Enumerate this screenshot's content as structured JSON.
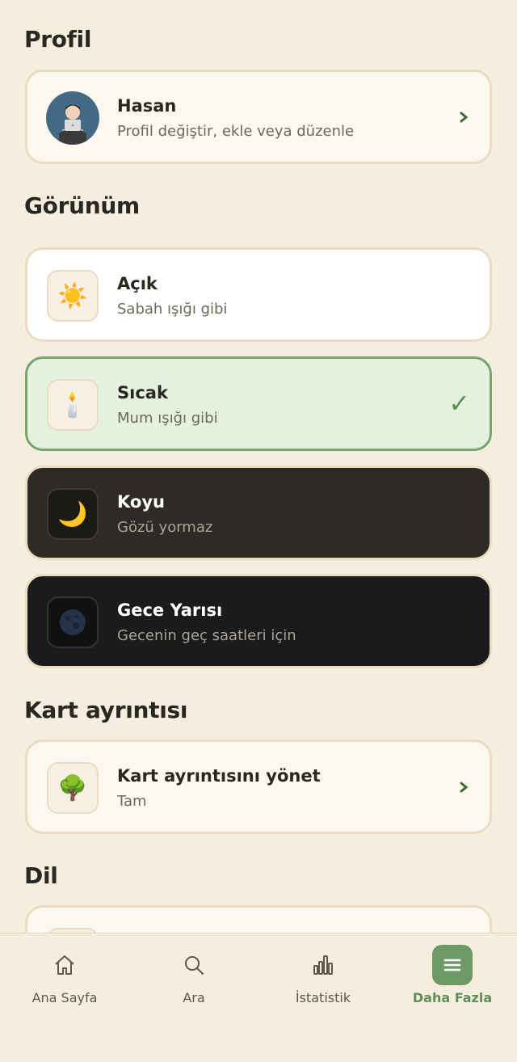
{
  "sections": {
    "profile": "Profil",
    "appearance": "Görünüm",
    "card_detail": "Kart ayrıntısı",
    "language": "Dil"
  },
  "profile": {
    "name": "Hasan",
    "subtitle": "Profil değiştir, ekle veya düzenle"
  },
  "themes": [
    {
      "title": "Açık",
      "subtitle": "Sabah ışığı gibi",
      "icon": "sun-icon",
      "glyph": "☀️"
    },
    {
      "title": "Sıcak",
      "subtitle": "Mum ışığı gibi",
      "icon": "candle-icon",
      "glyph": "🕯️",
      "selected": true
    },
    {
      "title": "Koyu",
      "subtitle": "Gözü yormaz",
      "icon": "moon-icon",
      "glyph": "🌙"
    },
    {
      "title": "Gece Yarısı",
      "subtitle": "Gecenin geç saatleri için",
      "icon": "dark-globe-icon",
      "glyph": "🌑"
    }
  ],
  "card_detail": {
    "title": "Kart ayrıntısını yönet",
    "subtitle": "Tam",
    "icon": "tree-icon",
    "glyph": "🌳"
  },
  "check_glyph": "✓",
  "tabs": [
    {
      "label": "Ana Sayfa",
      "icon": "home-icon"
    },
    {
      "label": "Ara",
      "icon": "search-icon"
    },
    {
      "label": "İstatistik",
      "icon": "stats-icon"
    },
    {
      "label": "Daha Fazla",
      "icon": "menu-icon",
      "active": true
    }
  ],
  "colors": {
    "background": "#f5eedf",
    "accent": "#6d9a64",
    "selected_bg": "#e3f1de"
  }
}
